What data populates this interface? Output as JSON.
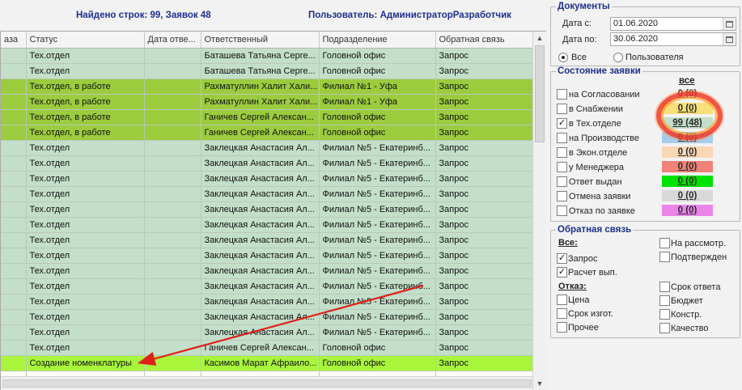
{
  "header": {
    "found_text": "Найдено строк: 99, Заявок 48",
    "user_text": "Пользователь: АдминистраторРазработчик"
  },
  "table": {
    "columns": [
      "аза",
      "Статус",
      "Дата отве...",
      "Ответственный",
      "Подразделение",
      "Обратная связь"
    ],
    "rows": [
      {
        "style": "tech",
        "cells": [
          "",
          "Тех.отдел",
          "",
          "Баташева Татьяна Серге...",
          "Головной офис",
          "Запрос"
        ]
      },
      {
        "style": "tech",
        "cells": [
          "",
          "Тех.отдел",
          "",
          "Баташева Татьяна Серге...",
          "Головной офис",
          "Запрос"
        ]
      },
      {
        "style": "work",
        "cells": [
          "",
          "Тех.отдел, в работе",
          "",
          "Рахматуллин Халит Хали...",
          "Филиал №1 - Уфа",
          "Запрос"
        ]
      },
      {
        "style": "work",
        "cells": [
          "",
          "Тех.отдел, в работе",
          "",
          "Рахматуллин Халит Хали...",
          "Филиал №1 - Уфа",
          "Запрос"
        ]
      },
      {
        "style": "work",
        "cells": [
          "",
          "Тех.отдел, в работе",
          "",
          "Ганичев Сергей Алексан...",
          "Головной офис",
          "Запрос"
        ]
      },
      {
        "style": "work",
        "cells": [
          "",
          "Тех.отдел, в работе",
          "",
          "Ганичев Сергей Алексан...",
          "Головной офис",
          "Запрос"
        ]
      },
      {
        "style": "tech",
        "cells": [
          "",
          "Тех.отдел",
          "",
          "Заклецкая Анастасия Ал...",
          "Филиал №5 - Екатеринб...",
          "Запрос"
        ]
      },
      {
        "style": "tech",
        "cells": [
          "",
          "Тех.отдел",
          "",
          "Заклецкая Анастасия Ал...",
          "Филиал №5 - Екатеринб...",
          "Запрос"
        ]
      },
      {
        "style": "tech",
        "cells": [
          "",
          "Тех.отдел",
          "",
          "Заклецкая Анастасия Ал...",
          "Филиал №5 - Екатеринб...",
          "Запрос"
        ]
      },
      {
        "style": "tech",
        "cells": [
          "",
          "Тех.отдел",
          "",
          "Заклецкая Анастасия Ал...",
          "Филиал №5 - Екатеринб...",
          "Запрос"
        ]
      },
      {
        "style": "tech",
        "cells": [
          "",
          "Тех.отдел",
          "",
          "Заклецкая Анастасия Ал...",
          "Филиал №5 - Екатеринб...",
          "Запрос"
        ]
      },
      {
        "style": "tech",
        "cells": [
          "",
          "Тех.отдел",
          "",
          "Заклецкая Анастасия Ал...",
          "Филиал №5 - Екатеринб...",
          "Запрос"
        ]
      },
      {
        "style": "tech",
        "cells": [
          "",
          "Тех.отдел",
          "",
          "Заклецкая Анастасия Ал...",
          "Филиал №5 - Екатеринб...",
          "Запрос"
        ]
      },
      {
        "style": "tech",
        "cells": [
          "",
          "Тех.отдел",
          "",
          "Заклецкая Анастасия Ал...",
          "Филиал №5 - Екатеринб...",
          "Запрос"
        ]
      },
      {
        "style": "tech",
        "cells": [
          "",
          "Тех.отдел",
          "",
          "Заклецкая Анастасия Ал...",
          "Филиал №5 - Екатеринб...",
          "Запрос"
        ]
      },
      {
        "style": "tech",
        "cells": [
          "",
          "Тех.отдел",
          "",
          "Заклецкая Анастасия Ал...",
          "Филиал №5 - Екатеринб...",
          "Запрос"
        ]
      },
      {
        "style": "tech",
        "cells": [
          "",
          "Тех.отдел",
          "",
          "Заклецкая Анастасия Ал...",
          "Филиал №5 - Екатеринб...",
          "Запрос"
        ]
      },
      {
        "style": "tech",
        "cells": [
          "",
          "Тех.отдел",
          "",
          "Заклецкая Анастасия Ал...",
          "Филиал №5 - Екатеринб...",
          "Запрос"
        ]
      },
      {
        "style": "tech",
        "cells": [
          "",
          "Тех.отдел",
          "",
          "Заклецкая Анастасия Ал...",
          "Филиал №5 - Екатеринб...",
          "Запрос"
        ]
      },
      {
        "style": "tech",
        "cells": [
          "",
          "Тех.отдел",
          "",
          "Ганичев Сергей Алексан...",
          "Головной офис",
          "Запрос"
        ]
      },
      {
        "style": "sel",
        "cells": [
          "",
          "Создание номенклатуры",
          "",
          "Касимов Марат Афраило...",
          "Головной офис",
          "Запрос"
        ]
      },
      {
        "style": "blank",
        "cells": [
          "",
          "",
          "",
          "",
          "",
          ""
        ]
      }
    ]
  },
  "docs": {
    "legend": "Документы",
    "date_from_label": "Дата с:",
    "date_from_value": "01.06.2020",
    "date_to_label": "Дата по:",
    "date_to_value": "30.06.2020",
    "radio_all": "Все",
    "radio_user": "Пользователя",
    "selected_radio": "all"
  },
  "state": {
    "legend": "Состояние заявки",
    "all_header": "все",
    "items": [
      {
        "label": "на Согласовании",
        "checked": false,
        "count": "0 (0)",
        "color": "#f2f2f2"
      },
      {
        "label": "в Снабжении",
        "checked": false,
        "count": "0 (0)",
        "color": "#f7e07a"
      },
      {
        "label": "в Тех.отделе",
        "checked": true,
        "count": "99 (48)",
        "color": "#c3dfc9"
      },
      {
        "label": "на Производстве",
        "checked": false,
        "count": "0 (0)",
        "color": "#a8cdea"
      },
      {
        "label": "в Экон.отделе",
        "checked": false,
        "count": "0 (0)",
        "color": "#fad7b4"
      },
      {
        "label": "у Менеджера",
        "checked": false,
        "count": "0 (0)",
        "color": "#f08278"
      },
      {
        "label": "Ответ выдан",
        "checked": false,
        "count": "0 (0)",
        "color": "#00e200"
      },
      {
        "label": "Отмена заявки",
        "checked": false,
        "count": "0 (0)",
        "color": "#d9d9d9"
      },
      {
        "label": "Отказ по заявке",
        "checked": false,
        "count": "0 (0)",
        "color": "#ea86ea"
      }
    ]
  },
  "feedback": {
    "legend": "Обратная связь",
    "all_header": "Все:",
    "refusal_header": "Отказ:",
    "left_top": [
      {
        "label": "Запрос",
        "checked": true
      },
      {
        "label": "Расчет вып.",
        "checked": true
      }
    ],
    "right_top": [
      {
        "label": "На рассмотр.",
        "checked": false
      },
      {
        "label": "Подтвержден",
        "checked": false
      }
    ],
    "left_refusal": [
      {
        "label": "Цена",
        "checked": false
      },
      {
        "label": "Срок изгот.",
        "checked": false
      },
      {
        "label": "Прочее",
        "checked": false
      }
    ],
    "right_refusal": [
      {
        "label": "Срок ответа",
        "checked": false
      },
      {
        "label": "Бюджет",
        "checked": false
      },
      {
        "label": "Констр.",
        "checked": false
      },
      {
        "label": "Качество",
        "checked": false
      }
    ]
  }
}
